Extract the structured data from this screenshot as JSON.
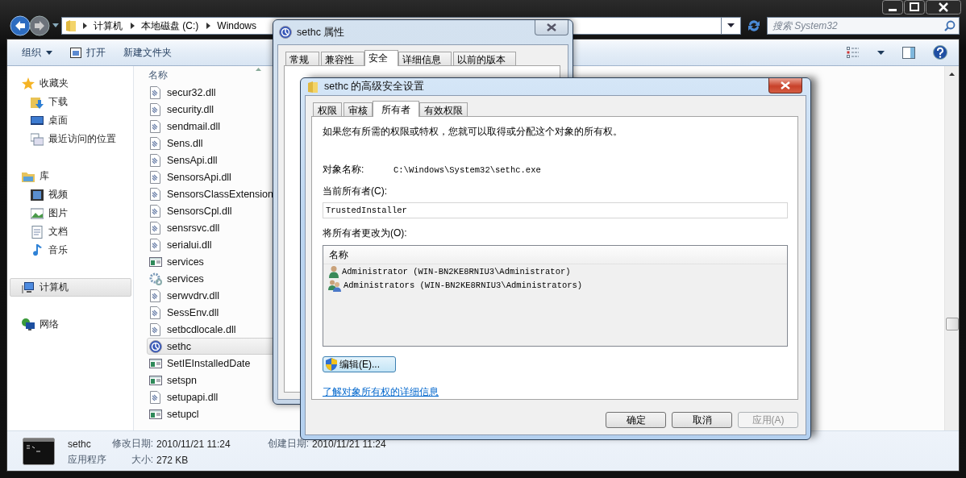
{
  "explorer": {
    "breadcrumbs": [
      "计算机",
      "本地磁盘 (C:)",
      "Windows"
    ],
    "search": {
      "placeholder": "搜索 System32"
    },
    "toolbar": [
      {
        "label": "组织",
        "kind": "menu"
      },
      {
        "label": "打开",
        "kind": "open"
      },
      {
        "label": "新建文件夹",
        "kind": "plain"
      }
    ],
    "sidebar": [
      {
        "label": "收藏夹",
        "kind": "star",
        "selected": false,
        "children": [
          {
            "label": "下载",
            "kind": "download",
            "selected": false
          },
          {
            "label": "桌面",
            "kind": "desktop",
            "selected": false
          },
          {
            "label": "最近访问的位置",
            "kind": "recent",
            "selected": false
          }
        ]
      },
      {
        "label": "库",
        "kind": "library",
        "selected": false,
        "children": [
          {
            "label": "视频",
            "kind": "video",
            "selected": false
          },
          {
            "label": "图片",
            "kind": "picture",
            "selected": false
          },
          {
            "label": "文档",
            "kind": "document",
            "selected": false
          },
          {
            "label": "音乐",
            "kind": "music",
            "selected": false
          }
        ]
      },
      {
        "label": "计算机",
        "kind": "computer",
        "selected": true
      },
      {
        "label": "网络",
        "kind": "network",
        "selected": false
      }
    ],
    "column": "名称",
    "files": [
      {
        "name": "secur32.dll",
        "kind": "dll",
        "selected": false
      },
      {
        "name": "security.dll",
        "kind": "dll",
        "selected": false
      },
      {
        "name": "sendmail.dll",
        "kind": "dll",
        "selected": false
      },
      {
        "name": "Sens.dll",
        "kind": "dll",
        "selected": false
      },
      {
        "name": "SensApi.dll",
        "kind": "dll",
        "selected": false
      },
      {
        "name": "SensorsApi.dll",
        "kind": "dll",
        "selected": false
      },
      {
        "name": "SensorsClassExtension",
        "kind": "dll",
        "selected": false
      },
      {
        "name": "SensorsCpl.dll",
        "kind": "dll",
        "selected": false
      },
      {
        "name": "sensrsvc.dll",
        "kind": "dll",
        "selected": false
      },
      {
        "name": "serialui.dll",
        "kind": "dll",
        "selected": false
      },
      {
        "name": "services",
        "kind": "app",
        "selected": false
      },
      {
        "name": "services",
        "kind": "config",
        "selected": false
      },
      {
        "name": "serwvdrv.dll",
        "kind": "dll",
        "selected": false
      },
      {
        "name": "SessEnv.dll",
        "kind": "dll",
        "selected": false
      },
      {
        "name": "setbcdlocale.dll",
        "kind": "dll",
        "selected": false
      },
      {
        "name": "sethc",
        "kind": "access",
        "selected": true
      },
      {
        "name": "SetIEInstalledDate",
        "kind": "app",
        "selected": false
      },
      {
        "name": "setspn",
        "kind": "app",
        "selected": false
      },
      {
        "name": "setupapi.dll",
        "kind": "dll",
        "selected": false
      },
      {
        "name": "setupcl",
        "kind": "app",
        "selected": false
      }
    ],
    "details": {
      "name": "sethc",
      "type": "应用程序",
      "modified_label": "修改日期:",
      "modified": "2010/11/21 11:24",
      "created_label": "创建日期:",
      "created": "2010/11/21 11:24",
      "size_label": "大小:",
      "size": "272 KB"
    }
  },
  "properties_dialog": {
    "title": "sethc 属性",
    "tabs": [
      {
        "label": "常规",
        "selected": false
      },
      {
        "label": "兼容性",
        "selected": false
      },
      {
        "label": "安全",
        "selected": true
      },
      {
        "label": "详细信息",
        "selected": false
      },
      {
        "label": "以前的版本",
        "selected": false
      }
    ]
  },
  "advanced_dialog": {
    "title": "sethc 的高级安全设置",
    "tabs": [
      {
        "label": "权限",
        "selected": false
      },
      {
        "label": "审核",
        "selected": false
      },
      {
        "label": "所有者",
        "selected": true
      },
      {
        "label": "有效权限",
        "selected": false
      }
    ],
    "intro": "如果您有所需的权限或特权，您就可以取得或分配这个对象的所有权。",
    "object_label": "对象名称:",
    "object_value": "C:\\Windows\\System32\\sethc.exe",
    "owner_label": "当前所有者(C):",
    "owner_value": "TrustedInstaller",
    "change_label": "将所有者更改为(O):",
    "list_column": "名称",
    "accounts": [
      {
        "name": "Administrator (WIN-BN2KE8RNIU3\\Administrator)",
        "kind": "user",
        "selected": false
      },
      {
        "name": "Administrators (WIN-BN2KE8RNIU3\\Administrators)",
        "kind": "group",
        "selected": false
      }
    ],
    "edit_button": "编辑(E)...",
    "link": "了解对象所有权的详细信息",
    "buttons": [
      {
        "label": "确定",
        "disabled": false
      },
      {
        "label": "取消",
        "disabled": false
      },
      {
        "label": "应用(A)",
        "disabled": true
      }
    ]
  }
}
